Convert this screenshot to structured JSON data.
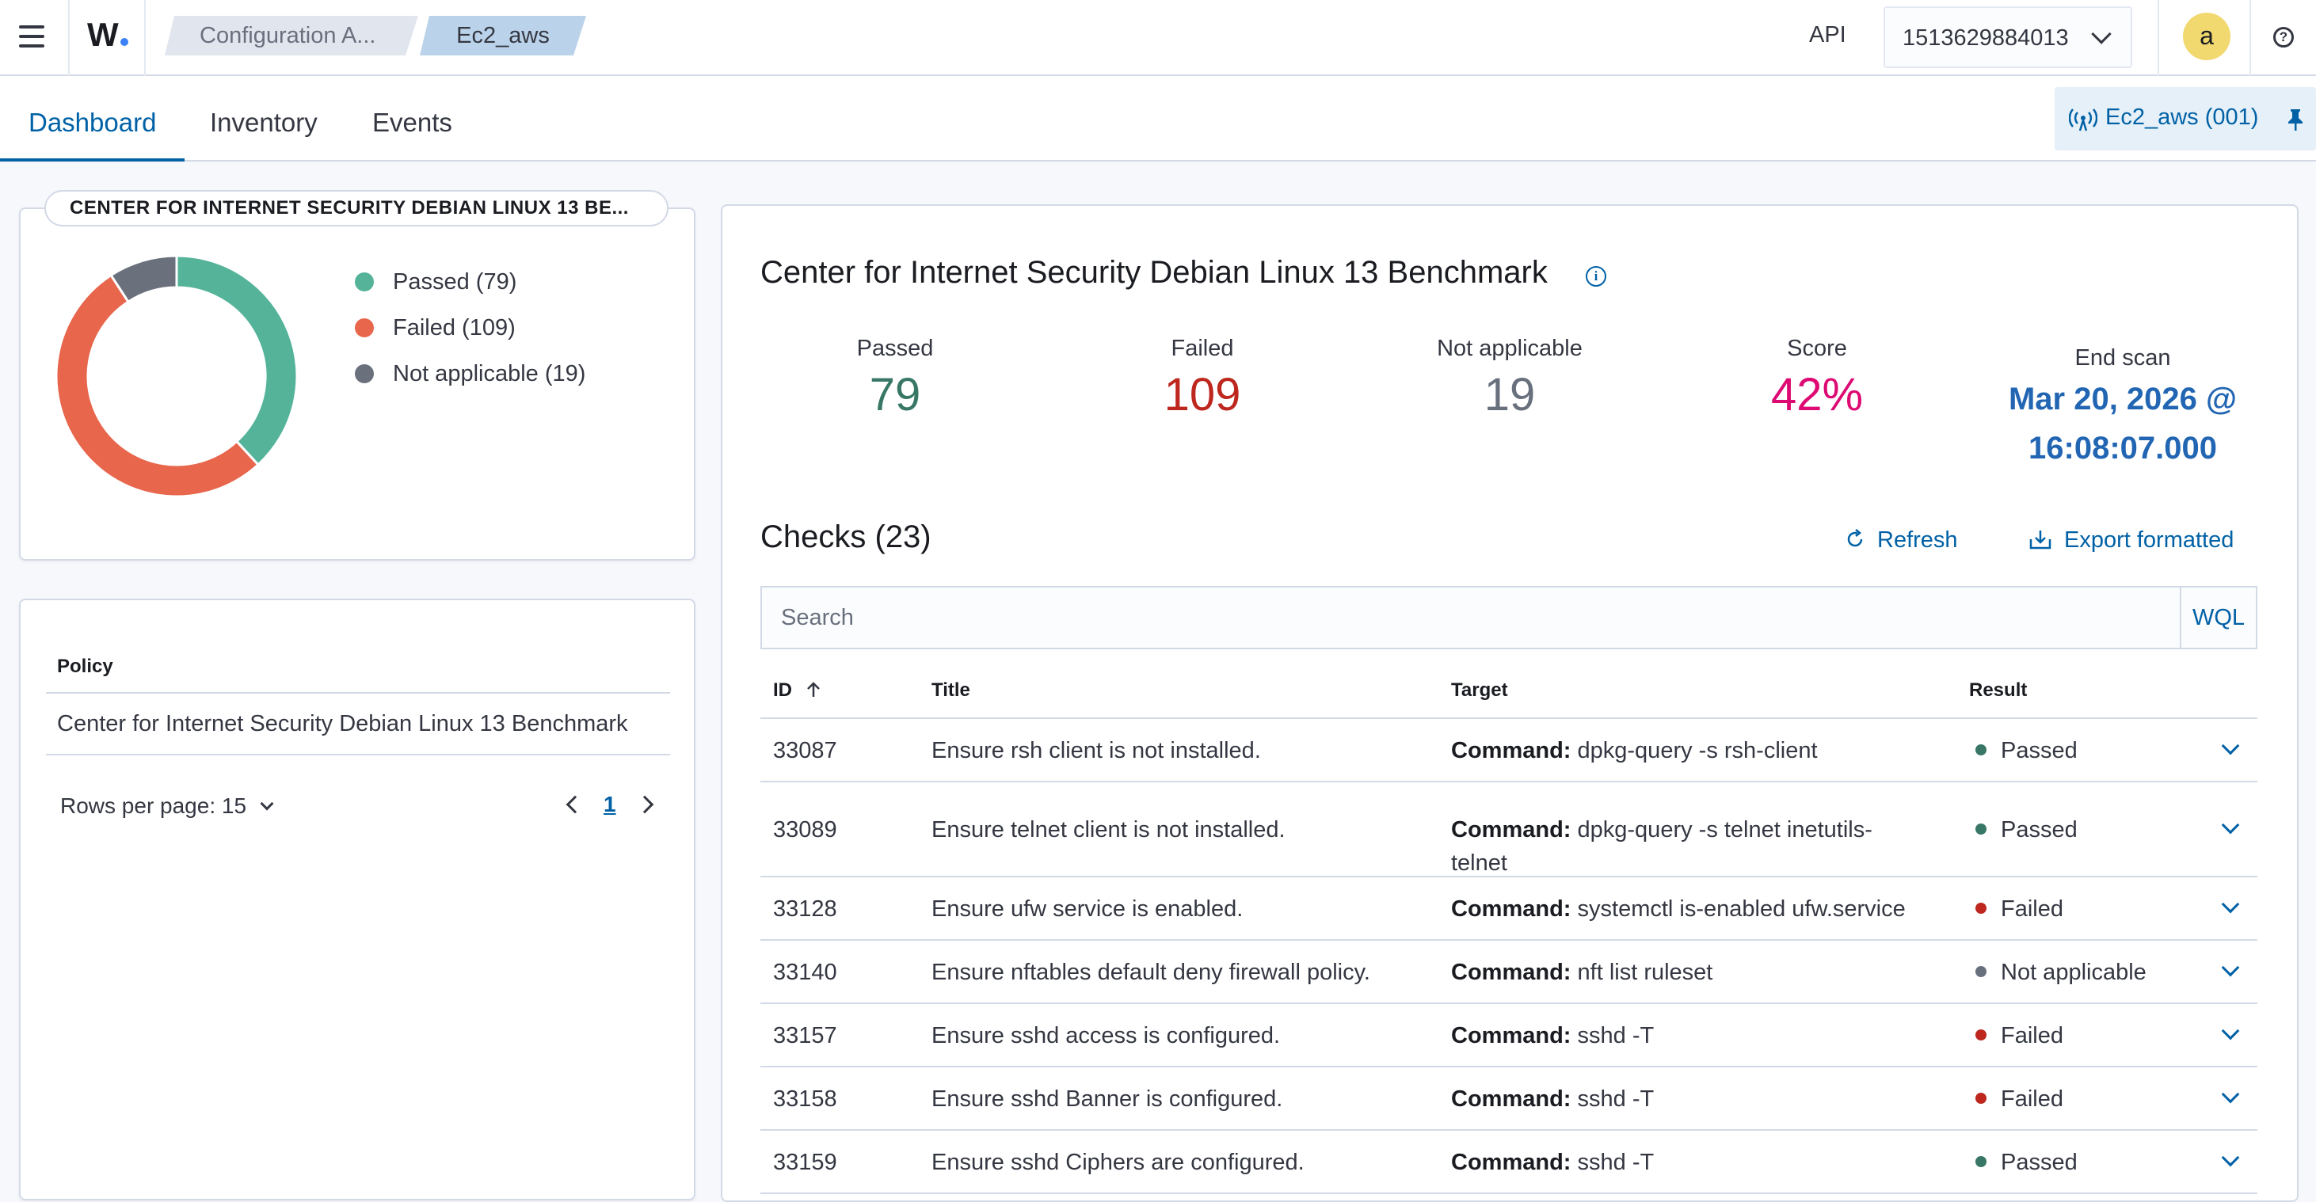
{
  "header": {
    "breadcrumbs": [
      "Configuration A...",
      "Ec2_aws"
    ],
    "api_label": "API",
    "api_value": "1513629884013",
    "avatar_letter": "a",
    "help_glyph": "?"
  },
  "tabs": [
    "Dashboard",
    "Inventory",
    "Events"
  ],
  "active_tab": "Dashboard",
  "agent_badge": "Ec2_aws (001)",
  "summary_card": {
    "title": "CENTER FOR INTERNET SECURITY DEBIAN LINUX 13 BE...",
    "legend": [
      {
        "label": "Passed (79)",
        "value": 79,
        "color": "#54b399"
      },
      {
        "label": "Failed (109)",
        "value": 109,
        "color": "#e7664c"
      },
      {
        "label": "Not applicable (19)",
        "value": 19,
        "color": "#6a717d"
      }
    ]
  },
  "policy_card": {
    "header": "Policy",
    "value": "Center for Internet Security Debian Linux 13 Benchmark",
    "rows_per_page": "Rows per page: 15",
    "page": "1"
  },
  "main": {
    "title": "Center for Internet Security Debian Linux 13 Benchmark",
    "stats": [
      {
        "label": "Passed",
        "value": "79",
        "color": "#387765"
      },
      {
        "label": "Failed",
        "value": "109",
        "color": "#bd271e"
      },
      {
        "label": "Not applicable",
        "value": "19",
        "color": "#69707d"
      },
      {
        "label": "Score",
        "value": "42%",
        "color": "#dd0a73"
      }
    ],
    "end_scan_label": "End scan",
    "end_scan_value": "Mar 20, 2026 @ 16:08:07.000",
    "checks_title": "Checks (23)",
    "refresh_label": "Refresh",
    "export_label": "Export formatted",
    "search_placeholder": "Search",
    "wql_label": "WQL",
    "columns": {
      "id": "ID",
      "title": "Title",
      "target": "Target",
      "result": "Result"
    },
    "target_prefix": "Command:",
    "rows": [
      {
        "id": "33087",
        "title": "Ensure rsh client is not installed.",
        "target": "dpkg-query -s rsh-client",
        "result": "Passed",
        "color": "#387765"
      },
      {
        "id": "33089",
        "title": "Ensure telnet client is not installed.",
        "target": "dpkg-query -s telnet inetutils-telnet",
        "result": "Passed",
        "color": "#387765"
      },
      {
        "id": "33128",
        "title": "Ensure ufw service is enabled.",
        "target": "systemctl is-enabled ufw.service",
        "result": "Failed",
        "color": "#bd271e"
      },
      {
        "id": "33140",
        "title": "Ensure nftables default deny firewall policy.",
        "target": "nft list ruleset",
        "result": "Not applicable",
        "color": "#69707d"
      },
      {
        "id": "33157",
        "title": "Ensure sshd access is configured.",
        "target": "sshd -T",
        "result": "Failed",
        "color": "#bd271e"
      },
      {
        "id": "33158",
        "title": "Ensure sshd Banner is configured.",
        "target": "sshd -T",
        "result": "Failed",
        "color": "#bd271e"
      },
      {
        "id": "33159",
        "title": "Ensure sshd Ciphers are configured.",
        "target": "sshd -T",
        "result": "Passed",
        "color": "#387765"
      }
    ]
  }
}
